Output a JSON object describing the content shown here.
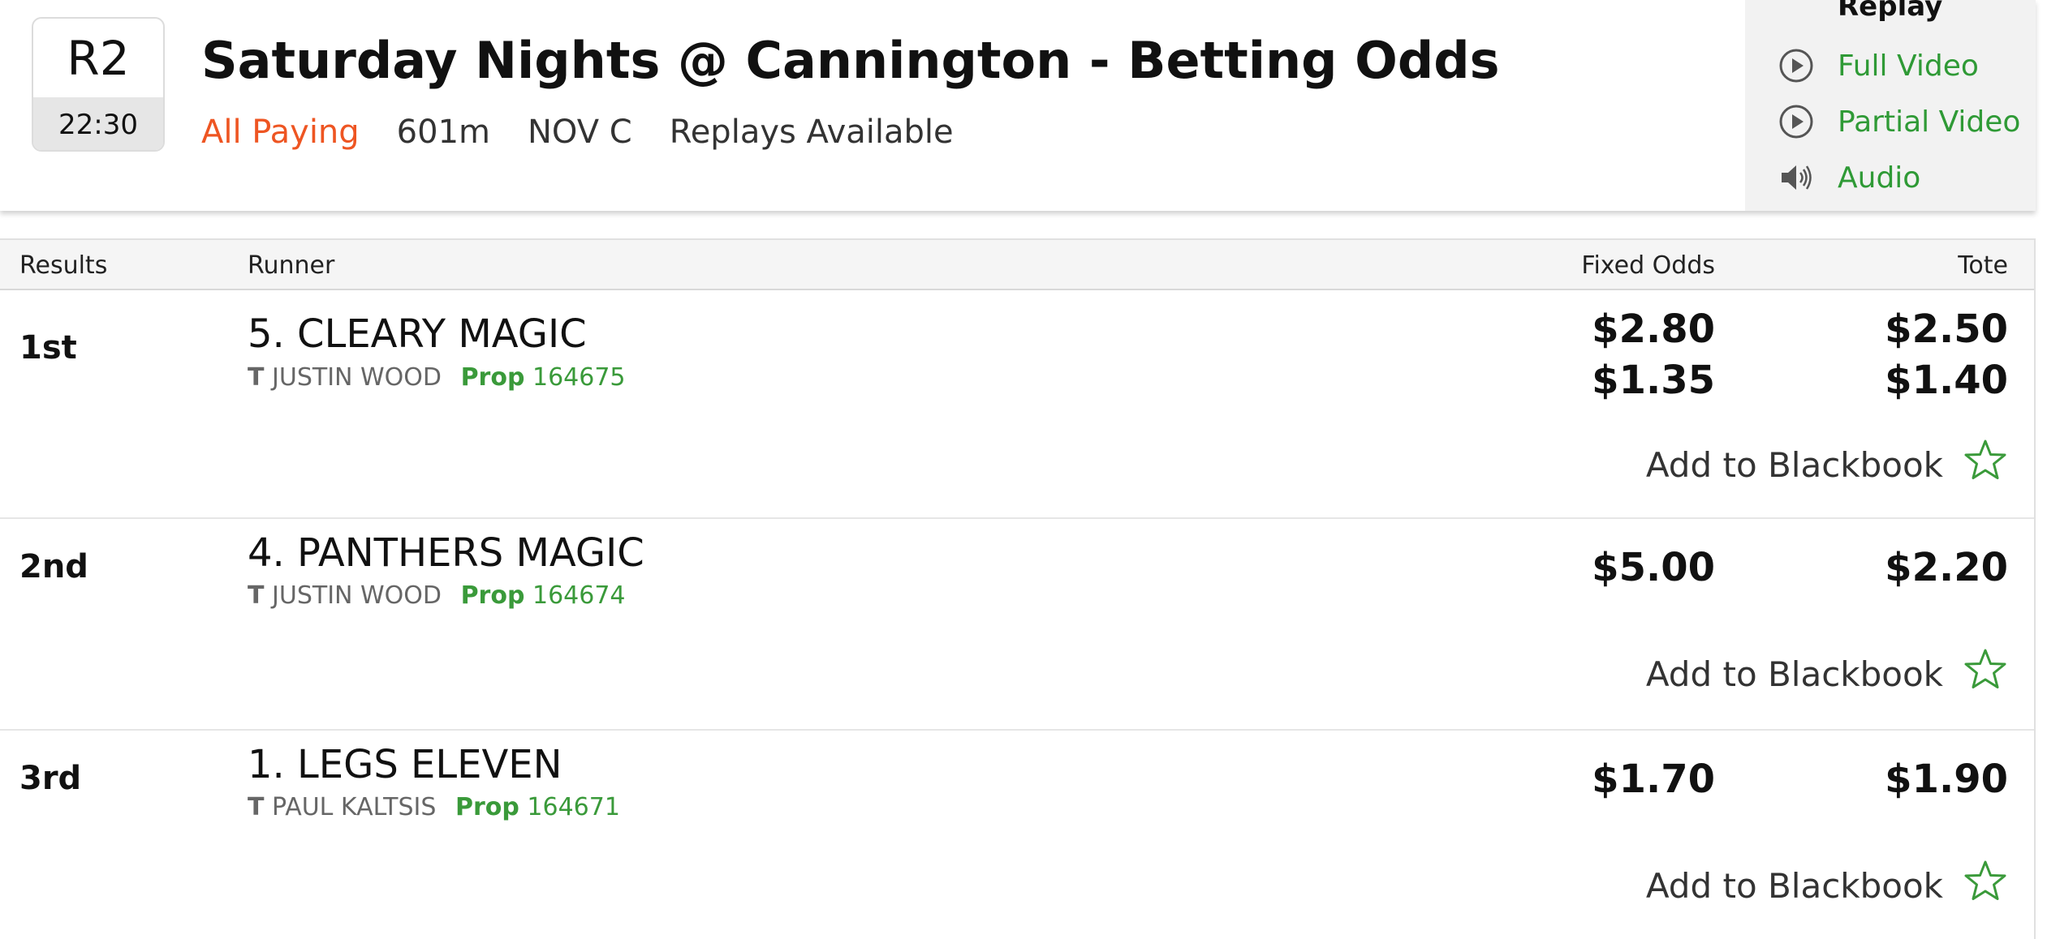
{
  "race": {
    "number": "R2",
    "time": "22:30",
    "title": "Saturday Nights @ Cannington - Betting Odds",
    "status": "All Paying",
    "distance": "601m",
    "grade": "NOV C",
    "replays": "Replays Available"
  },
  "replay": {
    "title": "Replay",
    "links": [
      {
        "label": "Full Video",
        "icon": "play-circle-icon"
      },
      {
        "label": "Partial Video",
        "icon": "play-circle-icon"
      },
      {
        "label": "Audio",
        "icon": "speaker-icon"
      }
    ]
  },
  "table": {
    "headers": {
      "results": "Results",
      "runner": "Runner",
      "fixed": "Fixed Odds",
      "tote": "Tote"
    },
    "rows": [
      {
        "position": "1st",
        "runner": "5. CLEARY MAGIC",
        "trainer_prefix": "T",
        "trainer": "JUSTIN WOOD",
        "prop_label": "Prop",
        "prop_number": "164675",
        "fixed_odds": [
          "$2.80",
          "$1.35"
        ],
        "tote": [
          "$2.50",
          "$1.40"
        ],
        "blackbook": "Add to Blackbook"
      },
      {
        "position": "2nd",
        "runner": "4. PANTHERS MAGIC",
        "trainer_prefix": "T",
        "trainer": "JUSTIN WOOD",
        "prop_label": "Prop",
        "prop_number": "164674",
        "fixed_odds": [
          "$5.00"
        ],
        "tote": [
          "$2.20"
        ],
        "blackbook": "Add to Blackbook"
      },
      {
        "position": "3rd",
        "runner": "1. LEGS ELEVEN",
        "trainer_prefix": "T",
        "trainer": "PAUL KALTSIS",
        "prop_label": "Prop",
        "prop_number": "164671",
        "fixed_odds": [
          "$1.70"
        ],
        "tote": [
          "$1.90"
        ],
        "blackbook": "Add to Blackbook"
      }
    ]
  },
  "colors": {
    "accent_green": "#2f9a36",
    "status_orange": "#ee5522"
  }
}
